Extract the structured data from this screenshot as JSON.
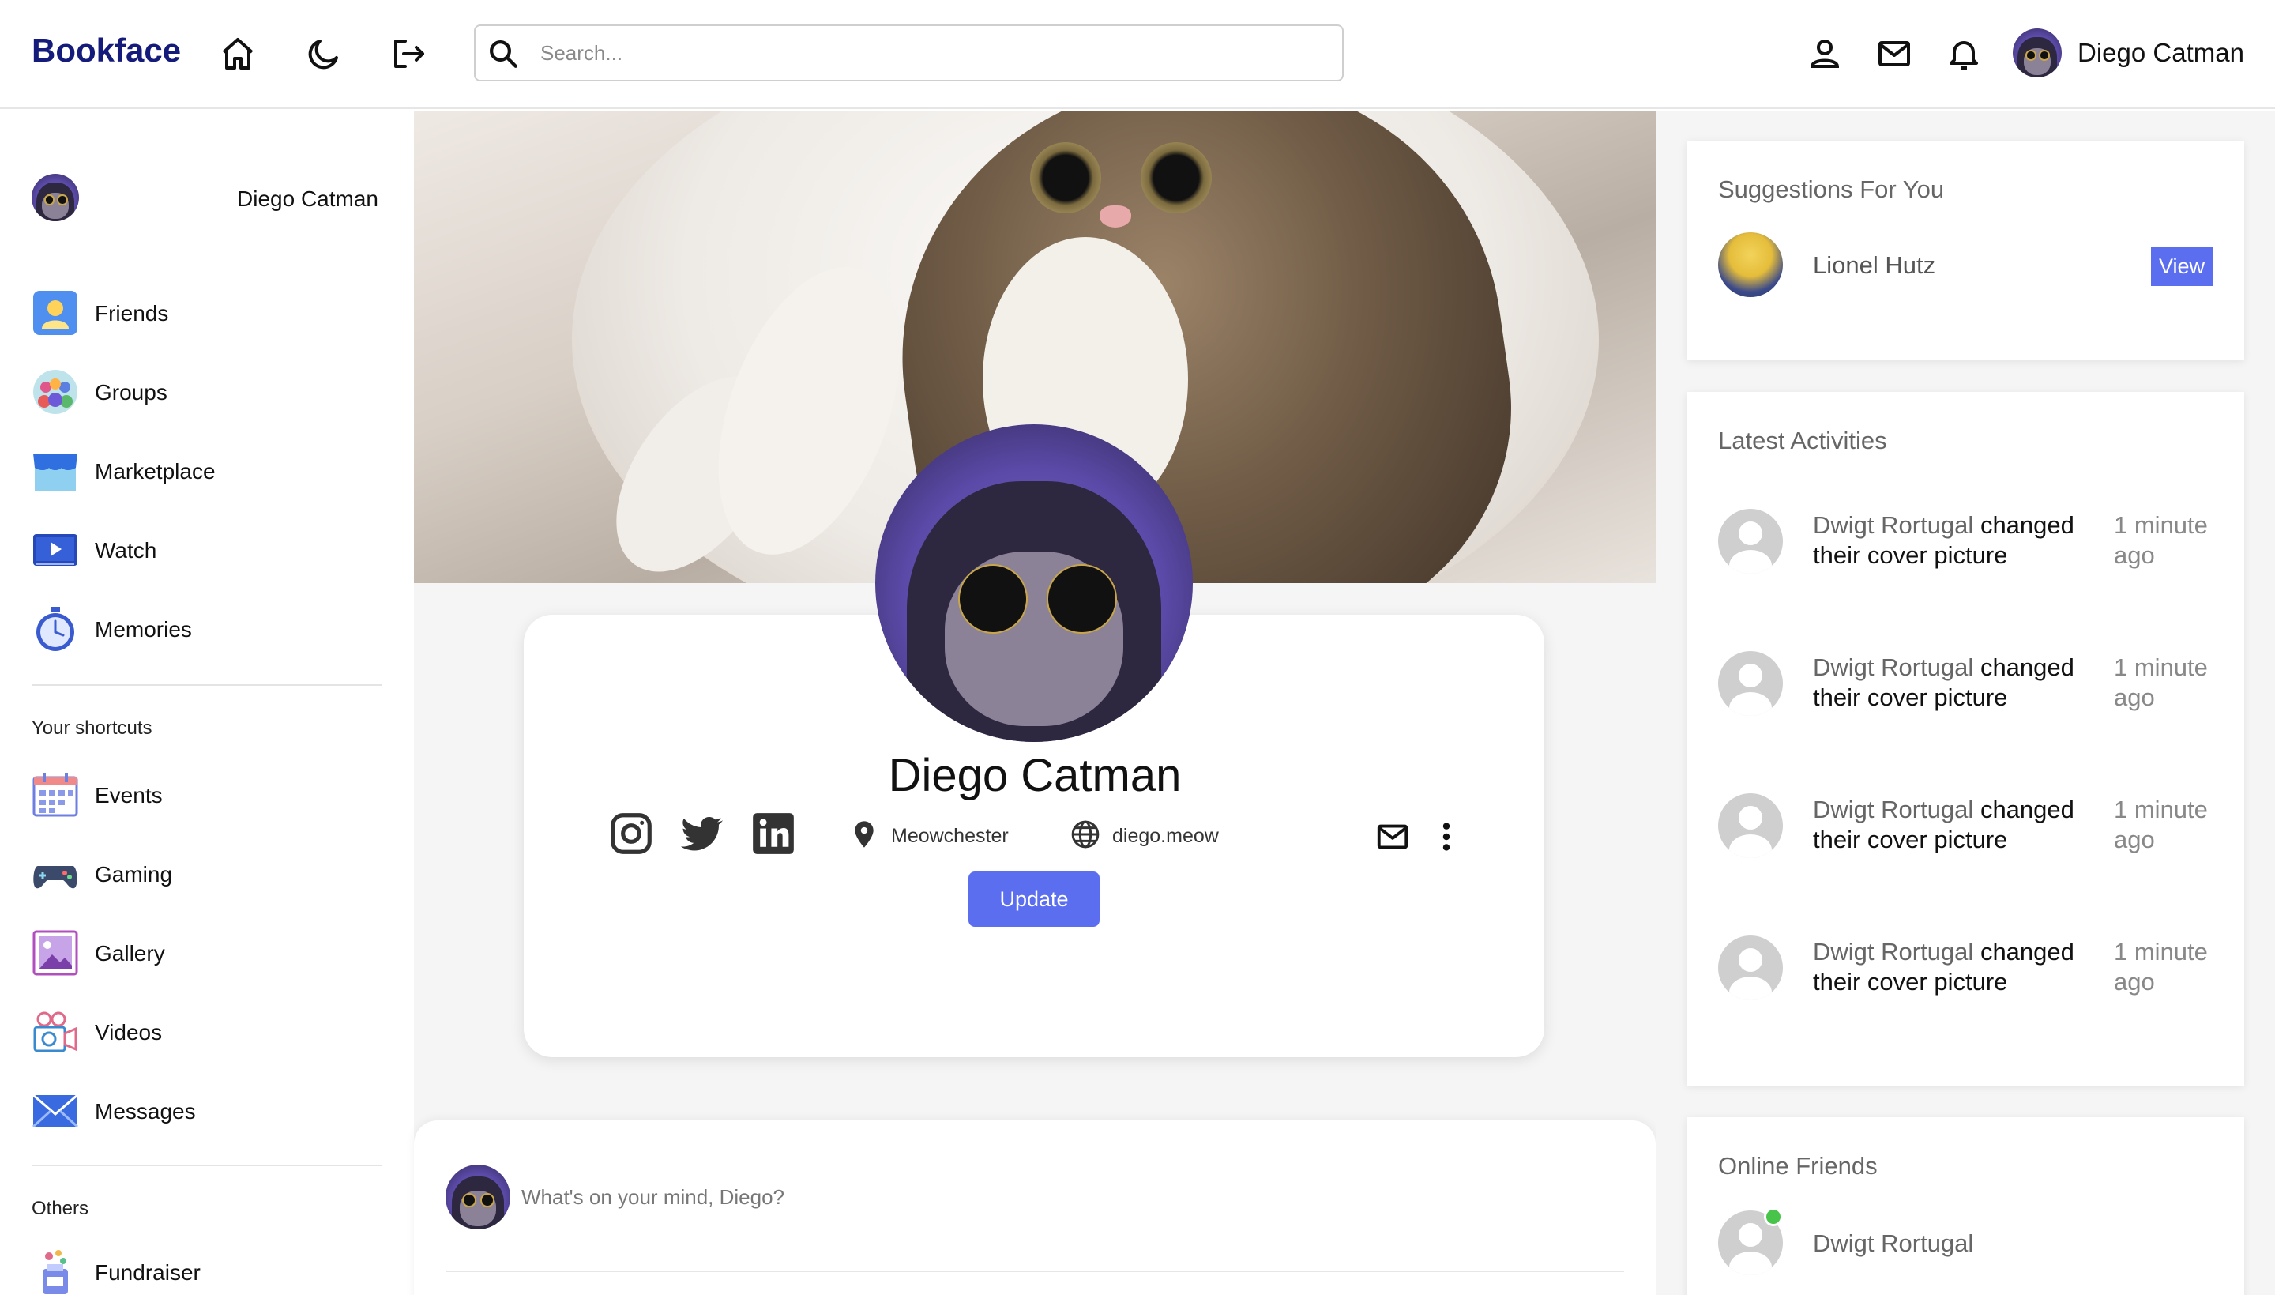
{
  "app": {
    "brand": "Bookface"
  },
  "header": {
    "search_placeholder": "Search...",
    "username": "Diego Catman",
    "icons": [
      "home-icon",
      "moon-icon",
      "logout-icon",
      "person-icon",
      "mail-icon",
      "bell-icon"
    ]
  },
  "sidebar": {
    "user_name": "Diego Catman",
    "main_items": [
      {
        "label": "Friends",
        "icon": "friends-icon"
      },
      {
        "label": "Groups",
        "icon": "groups-icon"
      },
      {
        "label": "Marketplace",
        "icon": "marketplace-icon"
      },
      {
        "label": "Watch",
        "icon": "watch-icon"
      },
      {
        "label": "Memories",
        "icon": "memories-icon"
      }
    ],
    "shortcuts_heading": "Your shortcuts",
    "shortcut_items": [
      {
        "label": "Events",
        "icon": "events-icon"
      },
      {
        "label": "Gaming",
        "icon": "gaming-icon"
      },
      {
        "label": "Gallery",
        "icon": "gallery-icon"
      },
      {
        "label": "Videos",
        "icon": "videos-icon"
      },
      {
        "label": "Messages",
        "icon": "messages-icon"
      }
    ],
    "others_heading": "Others",
    "other_items": [
      {
        "label": "Fundraiser",
        "icon": "fundraiser-icon"
      }
    ]
  },
  "profile": {
    "name": "Diego Catman",
    "location": "Meowchester",
    "website": "diego.meow",
    "update_label": "Update",
    "social": [
      "instagram-icon",
      "twitter-icon",
      "linkedin-icon"
    ]
  },
  "composer": {
    "placeholder": "What's on your mind, Diego?"
  },
  "right": {
    "suggestions": {
      "title": "Suggestions For You",
      "items": [
        {
          "name": "Lionel Hutz",
          "button": "View"
        }
      ]
    },
    "activities": {
      "title": "Latest Activities",
      "items": [
        {
          "who": "Dwigt Rortugal",
          "action": "changed their cover picture",
          "time": "1 minute ago"
        },
        {
          "who": "Dwigt Rortugal",
          "action": "changed their cover picture",
          "time": "1 minute ago"
        },
        {
          "who": "Dwigt Rortugal",
          "action": "changed their cover picture",
          "time": "1 minute ago"
        },
        {
          "who": "Dwigt Rortugal",
          "action": "changed their cover picture",
          "time": "1 minute ago"
        }
      ]
    },
    "online": {
      "title": "Online Friends",
      "items": [
        {
          "name": "Dwigt Rortugal"
        }
      ]
    }
  },
  "colors": {
    "brand": "#141b7a",
    "accent": "#5b6ef0",
    "online": "#47c449",
    "panel_bg": "#f5f5f5"
  }
}
